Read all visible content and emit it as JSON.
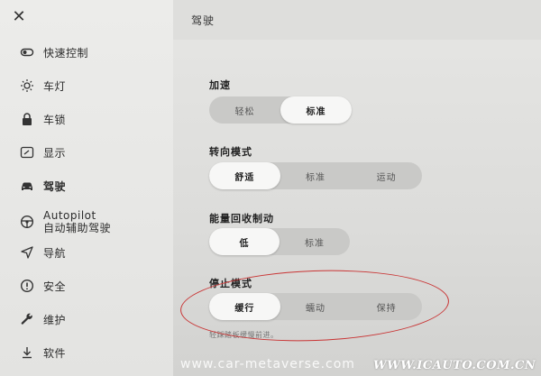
{
  "close_label": "✕",
  "sidebar": {
    "items": [
      {
        "label": "快速控制",
        "icon": "toggle-icon"
      },
      {
        "label": "车灯",
        "icon": "sun-icon"
      },
      {
        "label": "车锁",
        "icon": "lock-icon"
      },
      {
        "label": "显示",
        "icon": "display-icon"
      },
      {
        "label": "驾驶",
        "icon": "car-icon",
        "active": true
      },
      {
        "label": "Autopilot",
        "label2": "自动辅助驾驶",
        "icon": "steering-wheel-icon"
      },
      {
        "label": "导航",
        "icon": "navigation-arrow-icon"
      },
      {
        "label": "安全",
        "icon": "info-circle-icon"
      },
      {
        "label": "维护",
        "icon": "wrench-icon"
      },
      {
        "label": "软件",
        "icon": "download-icon"
      }
    ]
  },
  "main": {
    "title": "驾驶",
    "acceleration": {
      "label": "加速",
      "options": [
        "轻松",
        "标准"
      ],
      "selected": 1
    },
    "steering_mode": {
      "label": "转向模式",
      "options": [
        "舒适",
        "标准",
        "运动"
      ],
      "selected": 0
    },
    "regen_braking": {
      "label": "能量回收制动",
      "options": [
        "低",
        "标准"
      ],
      "selected": 0
    },
    "stopping_mode": {
      "label": "停止模式",
      "options": [
        "缓行",
        "蠕动",
        "保持"
      ],
      "selected": 0
    },
    "hint": "轻踩踏板缓慢前进。"
  },
  "watermarks": {
    "left": "www.car-metaverse.com",
    "right": "WWW.ICAUTO.COM.CN"
  },
  "colors": {
    "annotation_ellipse": "#c93434",
    "selected_segment": "#f7f7f6",
    "segment_track": "#c9c9c7"
  }
}
